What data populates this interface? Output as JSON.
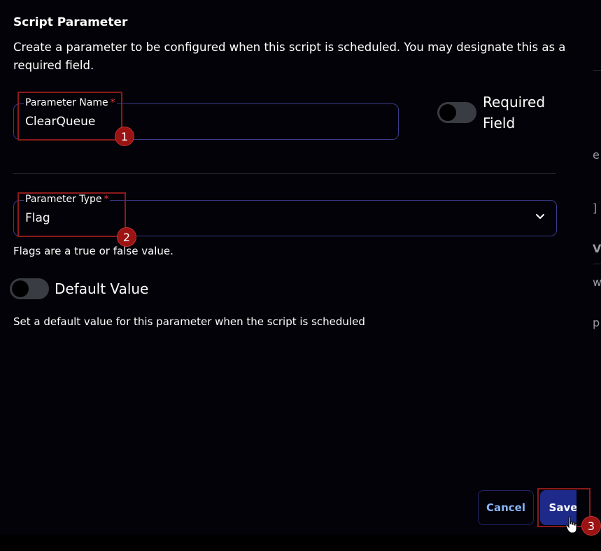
{
  "dialog": {
    "title": "Script Parameter",
    "description": "Create a parameter to be configured when this script is scheduled. You may designate this as a required field."
  },
  "parameter_name": {
    "label": "Parameter Name",
    "required_mark": "*",
    "value": "ClearQueue"
  },
  "required_field": {
    "label_line1": "Required",
    "label_line2": "Field",
    "enabled": false
  },
  "parameter_type": {
    "label": "Parameter Type",
    "required_mark": "*",
    "value": "Flag",
    "icon": "chevron-down-icon"
  },
  "flag_helper": "Flags are a true or false value.",
  "default_value": {
    "label": "Default Value",
    "enabled": false,
    "helper": "Set a default value for this parameter when the script is scheduled"
  },
  "actions": {
    "cancel": "Cancel",
    "save": "Save"
  },
  "annotations": [
    "1",
    "2",
    "3"
  ],
  "background_fragments": [
    "e",
    "]",
    "V",
    "w",
    "p"
  ],
  "colors": {
    "accent": "#1d2a8a",
    "field_border": "#3a3c8a",
    "required": "#e23b3b",
    "marker": "#9b1313",
    "cancel_text": "#8ab4f8"
  }
}
